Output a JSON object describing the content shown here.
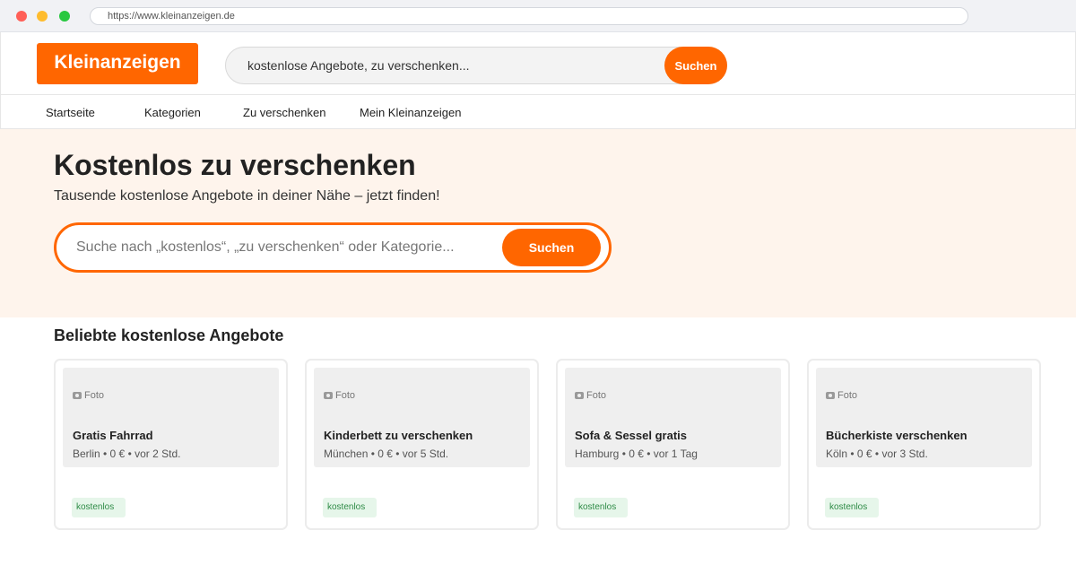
{
  "browser": {
    "url": "https://www.kleinanzeigen.de"
  },
  "header": {
    "logo": "Kleinanzeigen",
    "search_value": "kostenlose Angebote, zu verschenken...",
    "search_button": "Suchen"
  },
  "nav": {
    "items": [
      {
        "label": "Startseite"
      },
      {
        "label": "Kategorien"
      },
      {
        "label": "Zu verschenken"
      },
      {
        "label": "Mein Kleinanzeigen"
      }
    ]
  },
  "hero": {
    "title": "Kostenlos zu verschenken",
    "subtitle": "Tausende kostenlose Angebote in deiner Nähe – jetzt finden!",
    "search_placeholder": "Suche nach „kostenlos“, „zu verschenken“ oder Kategorie...",
    "search_button": "Suchen"
  },
  "listings": {
    "heading": "Beliebte kostenlose Angebote",
    "items": [
      {
        "photo_label": "Foto",
        "title": "Gratis Fahrrad",
        "meta": "Berlin • 0 € • vor 2 Std.",
        "badge": "kostenlos"
      },
      {
        "photo_label": "Foto",
        "title": "Kinderbett zu verschenken",
        "meta": "München • 0 € • vor 5 Std.",
        "badge": "kostenlos"
      },
      {
        "photo_label": "Foto",
        "title": "Sofa & Sessel gratis",
        "meta": "Hamburg • 0 € • vor 1 Tag",
        "badge": "kostenlos"
      },
      {
        "photo_label": "Foto",
        "title": "Bücherkiste verschenken",
        "meta": "Köln • 0 € • vor 3 Std.",
        "badge": "kostenlos"
      }
    ]
  },
  "colors": {
    "accent": "#ff6600",
    "hero_bg": "#fef4ec",
    "badge_bg": "#e6f6ea",
    "badge_text": "#2e8b46"
  }
}
